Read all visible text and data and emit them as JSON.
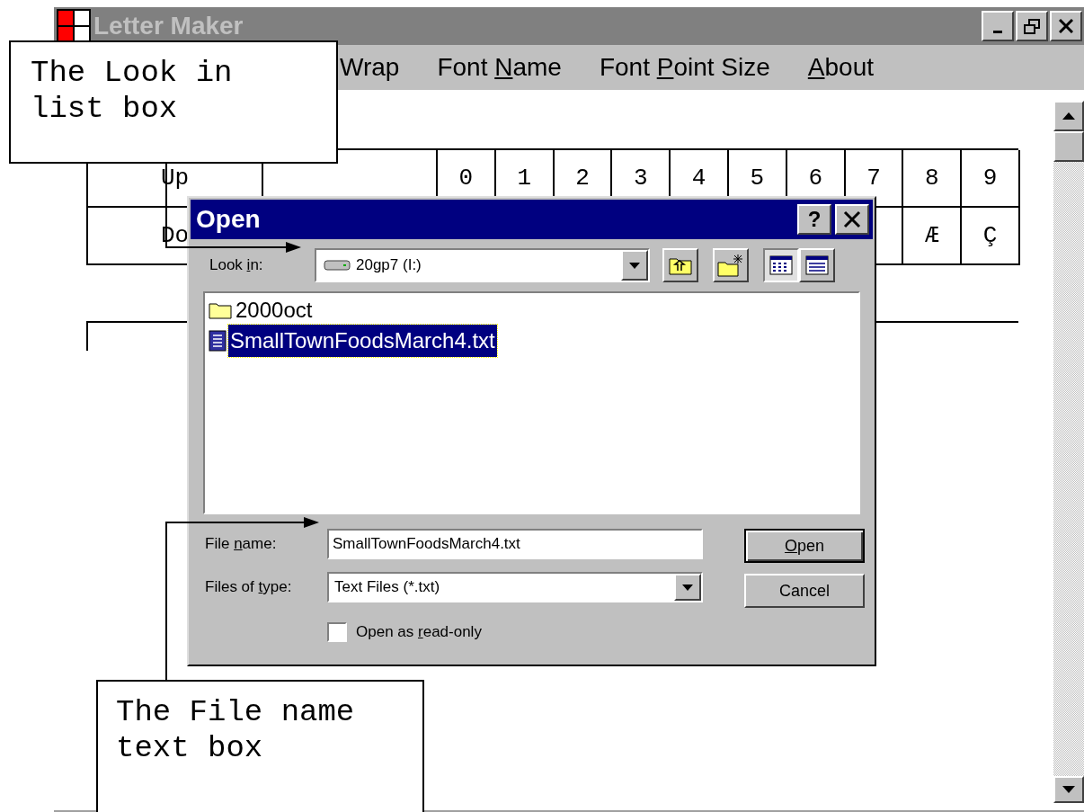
{
  "app_window": {
    "title": "Letter Maker",
    "menu": [
      {
        "parts": [
          {
            "text": "Wrap",
            "underline": false
          }
        ]
      },
      {
        "parts": [
          {
            "text": "Font ",
            "underline": false
          },
          {
            "text": "N",
            "underline": true
          },
          {
            "text": "ame",
            "underline": false
          }
        ]
      },
      {
        "parts": [
          {
            "text": "Font ",
            "underline": false
          },
          {
            "text": "P",
            "underline": true
          },
          {
            "text": "oint Size",
            "underline": false
          }
        ]
      },
      {
        "parts": [
          {
            "text": "A",
            "underline": true
          },
          {
            "text": "bout",
            "underline": false
          }
        ]
      }
    ],
    "table": {
      "rows": [
        {
          "label": "Up",
          "cells": [
            "0",
            "1",
            "2",
            "3",
            "4",
            "5",
            "6",
            "7",
            "8",
            "9"
          ]
        },
        {
          "label": "Do",
          "cells": [
            "",
            "",
            "",
            "",
            "",
            "",
            "",
            "",
            "Æ",
            "Ç"
          ]
        }
      ]
    }
  },
  "dialog": {
    "title": "Open",
    "help_button": "?",
    "look_in": {
      "label": [
        {
          "text": "Look ",
          "underline": false
        },
        {
          "text": "i",
          "underline": true
        },
        {
          "text": "n:",
          "underline": false
        }
      ],
      "value": "20gp7 (I:)"
    },
    "view_buttons": [
      {
        "kind": "list",
        "selected": true
      },
      {
        "kind": "details",
        "selected": false
      }
    ],
    "files": [
      {
        "name": "2000oct",
        "kind": "folder",
        "selected": false
      },
      {
        "name": "SmallTownFoodsMarch4.txt",
        "kind": "text_file",
        "selected": true
      }
    ],
    "file_name": {
      "label": [
        {
          "text": "File ",
          "underline": false
        },
        {
          "text": "n",
          "underline": true
        },
        {
          "text": "ame:",
          "underline": false
        }
      ],
      "value": "SmallTownFoodsMarch4.txt"
    },
    "file_type": {
      "label": [
        {
          "text": "Files of ",
          "underline": false
        },
        {
          "text": "t",
          "underline": true
        },
        {
          "text": "ype:",
          "underline": false
        }
      ],
      "value": "Text Files (*.txt)"
    },
    "read_only": {
      "label": [
        {
          "text": "Open as ",
          "underline": false
        },
        {
          "text": "r",
          "underline": true
        },
        {
          "text": "ead-only",
          "underline": false
        }
      ],
      "checked": false
    },
    "buttons": [
      {
        "parts": [
          {
            "text": "O",
            "underline": true
          },
          {
            "text": "pen",
            "underline": false
          }
        ],
        "default": true
      },
      {
        "parts": [
          {
            "text": "Cancel",
            "underline": false
          }
        ],
        "default": false
      }
    ]
  },
  "callouts": [
    {
      "text": "The Look in list box"
    },
    {
      "text": "The File name text box"
    }
  ]
}
